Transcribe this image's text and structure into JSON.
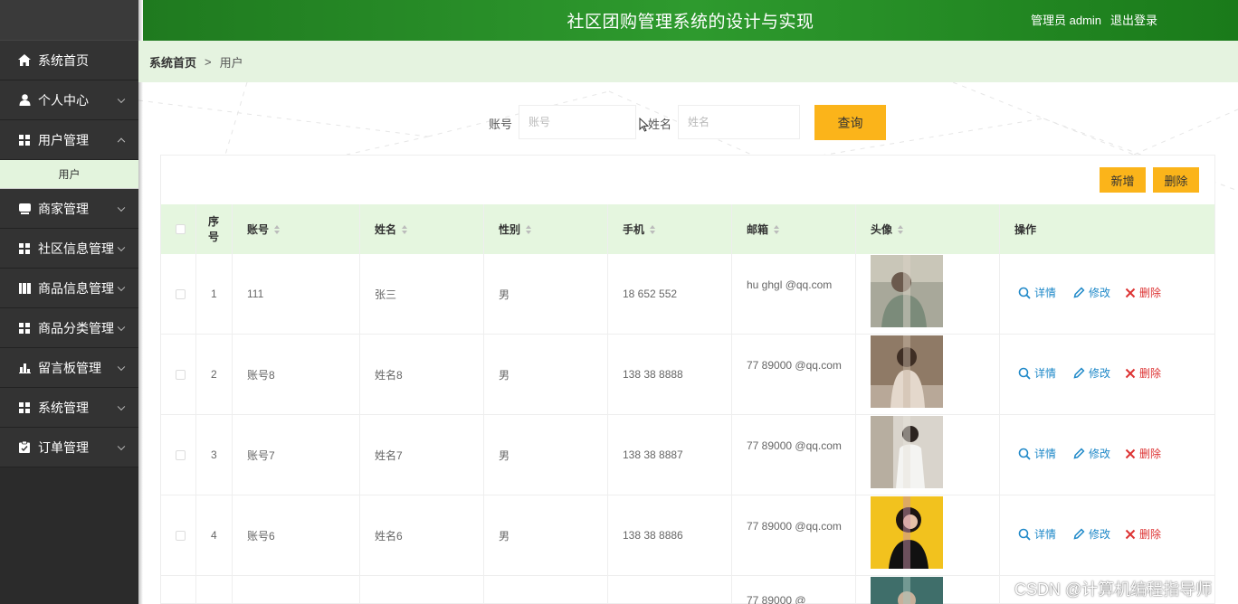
{
  "header": {
    "title": "社区团购管理系统的设计与实现",
    "user": "管理员 admin",
    "logout": "退出登录"
  },
  "sidebar": {
    "items": [
      {
        "label": "系统首页",
        "icon": "home-icon"
      },
      {
        "label": "个人中心",
        "icon": "user-icon"
      },
      {
        "label": "用户管理",
        "icon": "grid-icon",
        "expanded": true
      },
      {
        "label": "商家管理",
        "icon": "box-icon"
      },
      {
        "label": "社区信息管理",
        "icon": "grid-icon"
      },
      {
        "label": "商品信息管理",
        "icon": "book-icon"
      },
      {
        "label": "商品分类管理",
        "icon": "grid-icon"
      },
      {
        "label": "留言板管理",
        "icon": "bar-chart-icon"
      },
      {
        "label": "系统管理",
        "icon": "grid-icon"
      },
      {
        "label": "订单管理",
        "icon": "clipboard-icon"
      }
    ],
    "sub_item": "用户"
  },
  "breadcrumb": {
    "home": "系统首页",
    "sep": ">",
    "current": "用户"
  },
  "search": {
    "account_label": "账号",
    "account_placeholder": "账号",
    "name_label": "姓名",
    "name_placeholder": "姓名",
    "query_button": "查询"
  },
  "toolbar": {
    "add": "新增",
    "delete": "删除"
  },
  "table": {
    "headers": {
      "index": "序号",
      "account": "账号",
      "name": "姓名",
      "gender": "性别",
      "phone": "手机",
      "email": "邮箱",
      "avatar": "头像",
      "ops": "操作"
    },
    "rows": [
      {
        "index": "1",
        "account": "111",
        "name": "张三",
        "gender": "男",
        "phone": "18  652  552",
        "email": "hu   ghgl  @qq.com"
      },
      {
        "index": "2",
        "account": "账号8",
        "name": "姓名8",
        "gender": "男",
        "phone": "138  38  8888",
        "email": "77  89000  @qq.com"
      },
      {
        "index": "3",
        "account": "账号7",
        "name": "姓名7",
        "gender": "男",
        "phone": "138  38  8887",
        "email": "77  89000  @qq.com"
      },
      {
        "index": "4",
        "account": "账号6",
        "name": "姓名6",
        "gender": "男",
        "phone": "138  38  8886",
        "email": "77  89000  @qq.com"
      },
      {
        "index": "",
        "account": "",
        "name": "",
        "gender": "",
        "phone": "",
        "email": "77  89000  @"
      }
    ],
    "actions": {
      "detail": "详情",
      "edit": "修改",
      "delete": "删除"
    }
  },
  "watermark": "CSDN @计算机编程指导师",
  "colors": {
    "header_green": "#2e9a2e",
    "sidebar_dark": "#333333",
    "accent_yellow": "#fbb41a",
    "thead_bg": "#e5f6df",
    "link_blue": "#1e88c8",
    "delete_red": "#dd3333"
  }
}
